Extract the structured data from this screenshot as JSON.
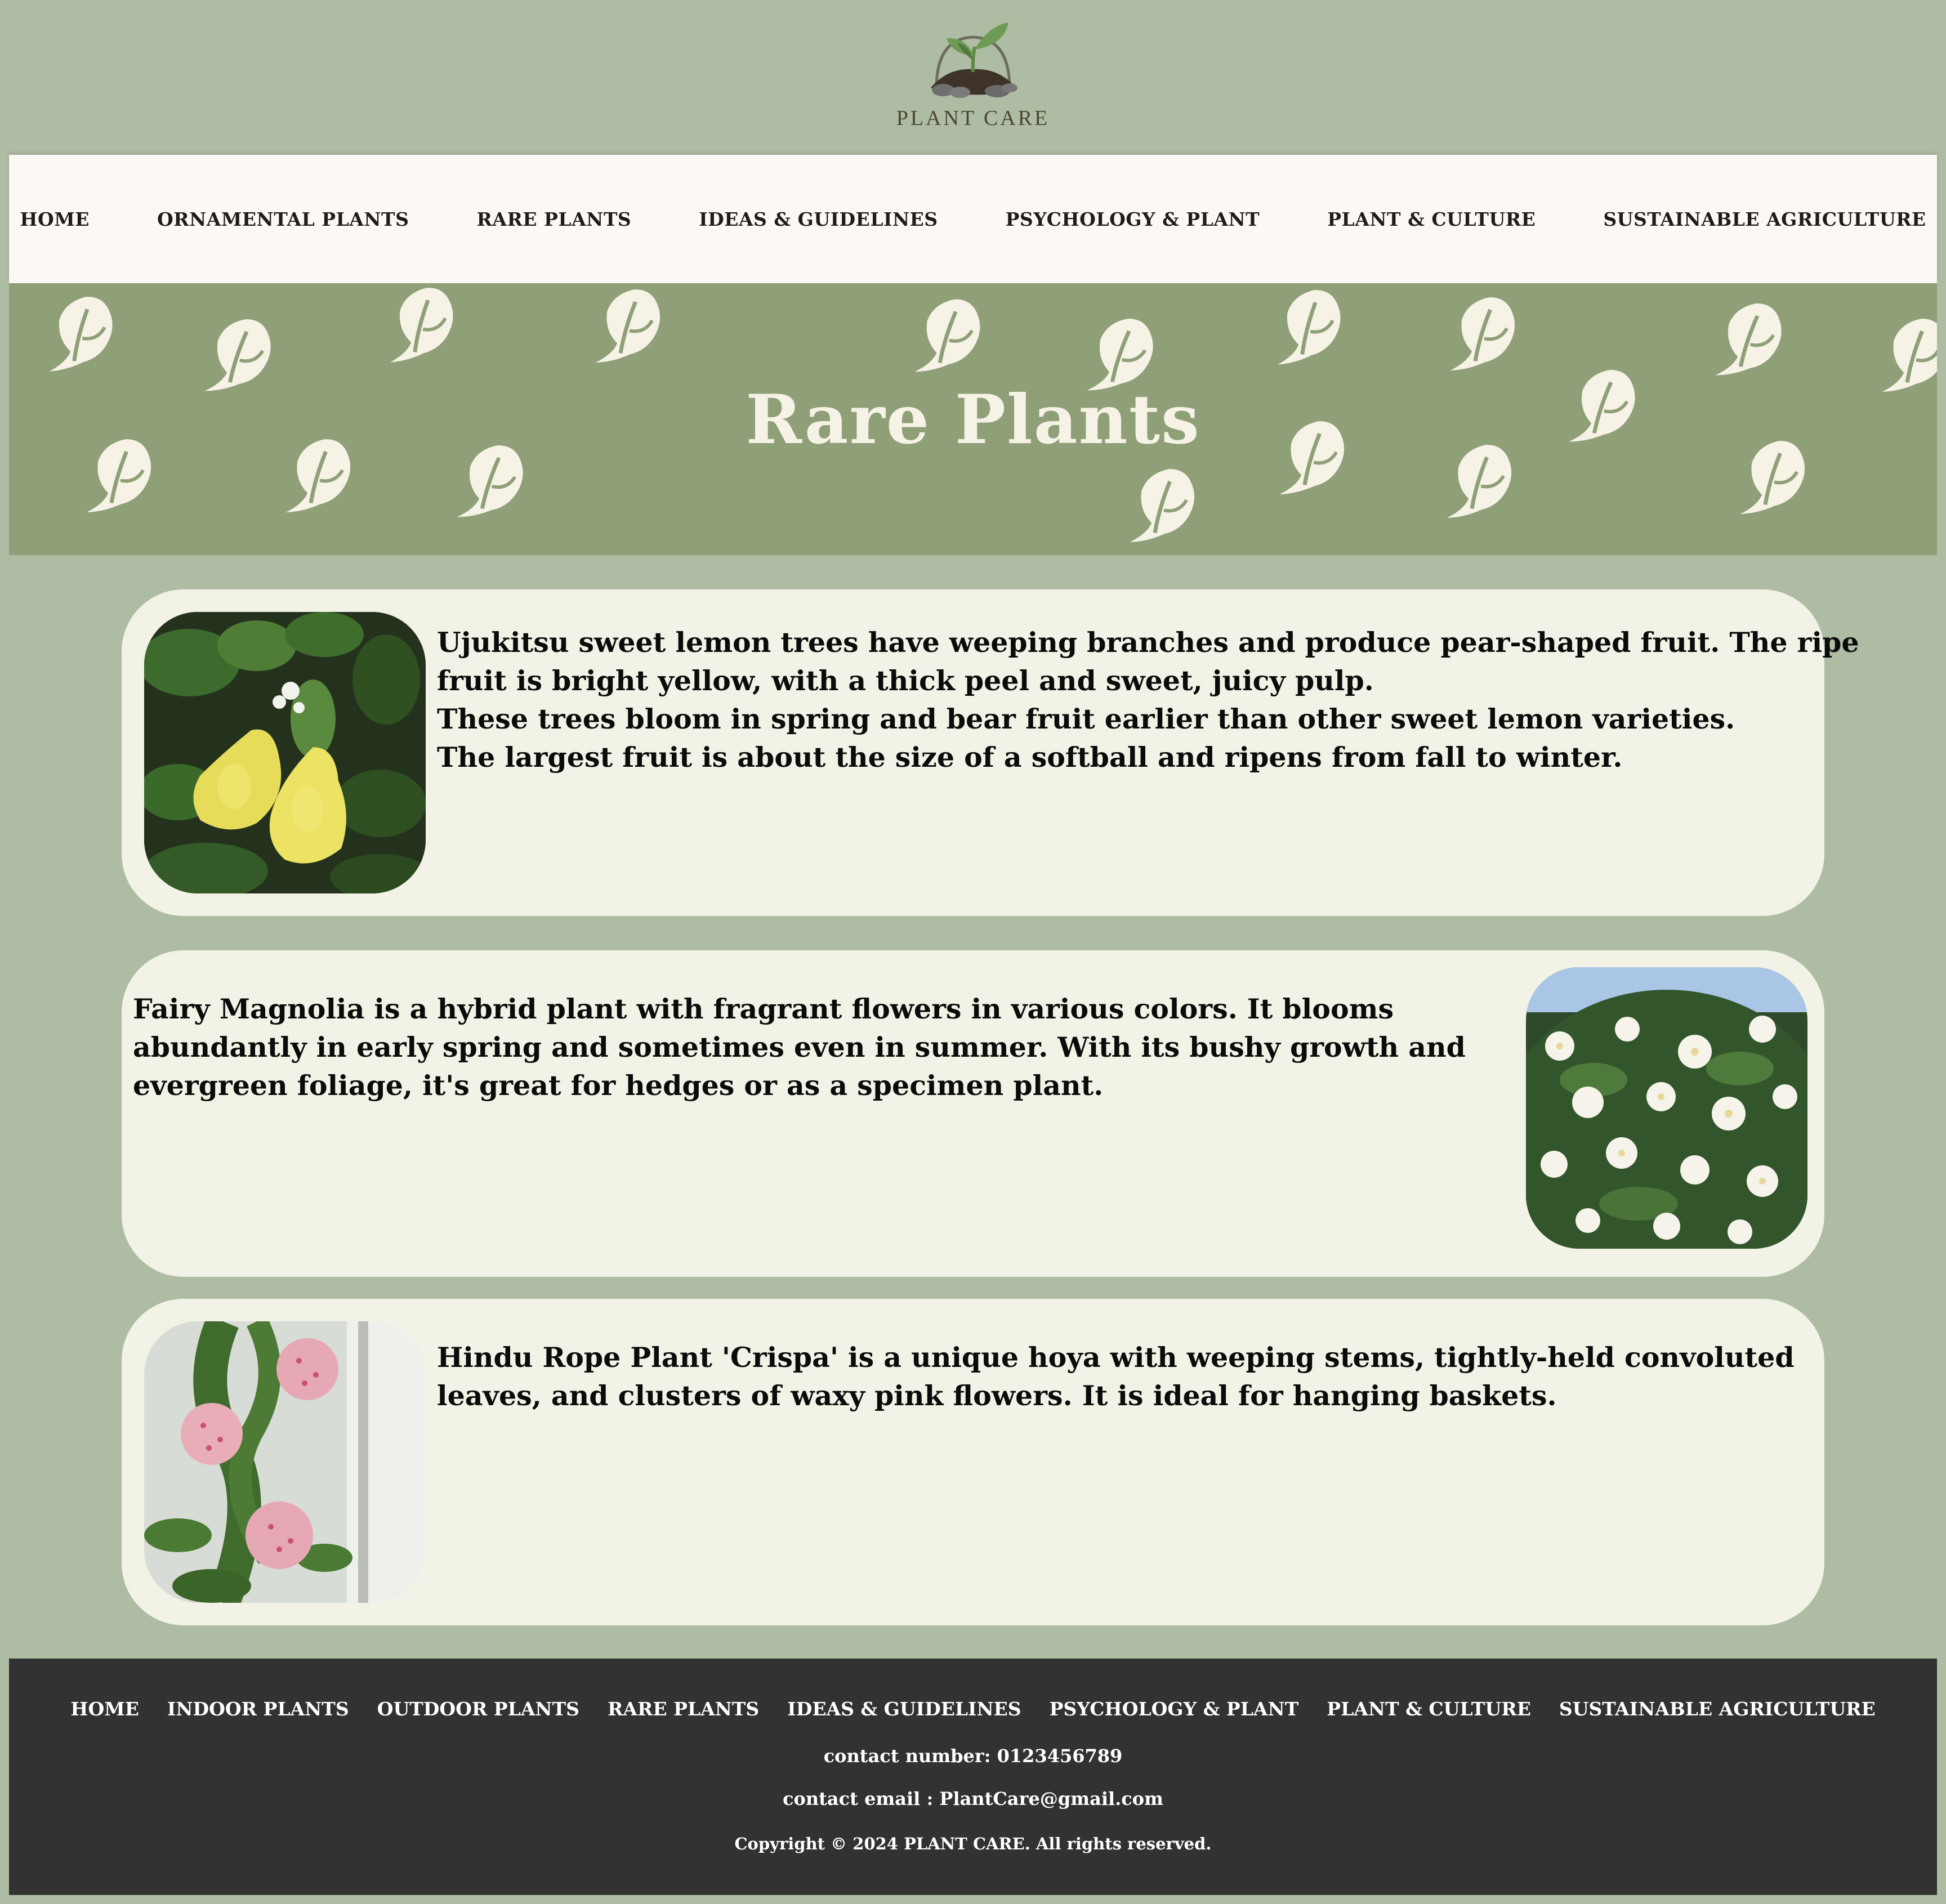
{
  "brand": {
    "name": "PLANT CARE",
    "logo_icon": "sprout-in-soil-icon"
  },
  "nav": {
    "items": [
      "HOME",
      "ORNAMENTAL PLANTS",
      "RARE PLANTS",
      "IDEAS & GUIDELINES",
      "PSYCHOLOGY & PLANT",
      "PLANT & CULTURE",
      "SUSTAINABLE AGRICULTURE"
    ]
  },
  "hero": {
    "title": "Rare Plants",
    "pattern_icon": "leaf-icon"
  },
  "cards": [
    {
      "image": "ujukitsu-lemon-photo",
      "lines": [
        "Ujukitsu sweet lemon trees have weeping branches and produce pear-shaped fruit. The ripe",
        "fruit is bright yellow, with a thick peel and sweet, juicy pulp.",
        "These trees bloom in spring and bear fruit earlier than other sweet lemon varieties.",
        "The largest fruit is about the size of a softball and ripens from fall to winter."
      ]
    },
    {
      "image": "fairy-magnolia-photo",
      "lines": [
        "Fairy Magnolia is a hybrid plant with fragrant flowers in various colors. It blooms",
        "abundantly in early spring and sometimes even in summer. With its bushy growth and",
        "evergreen foliage, it's great for hedges or as a specimen plant."
      ]
    },
    {
      "image": "hindu-rope-plant-photo",
      "lines": [
        "Hindu Rope Plant 'Crispa' is a unique hoya with weeping stems, tightly-held convoluted",
        "leaves, and clusters of waxy pink flowers. It is ideal for hanging baskets."
      ]
    }
  ],
  "footer": {
    "links": [
      "HOME",
      "INDOOR PLANTS",
      "OUTDOOR PLANTS",
      "RARE PLANTS",
      "IDEAS & GUIDELINES",
      "PSYCHOLOGY & PLANT",
      "PLANT & CULTURE",
      "SUSTAINABLE AGRICULTURE"
    ],
    "contact_number": "contact number: 0123456789",
    "contact_email": "contact email : PlantCare@gmail.com",
    "copyright": "Copyright © 2024 PLANT CARE. All rights reserved."
  },
  "colors": {
    "page_bg": "#adbca2",
    "nav_bg": "#fdf8f3",
    "hero_bg": "#8f9f78",
    "hero_leaf": "#f6f3e6",
    "card_bg": "#f2f2e6",
    "footer_bg": "#323232"
  }
}
